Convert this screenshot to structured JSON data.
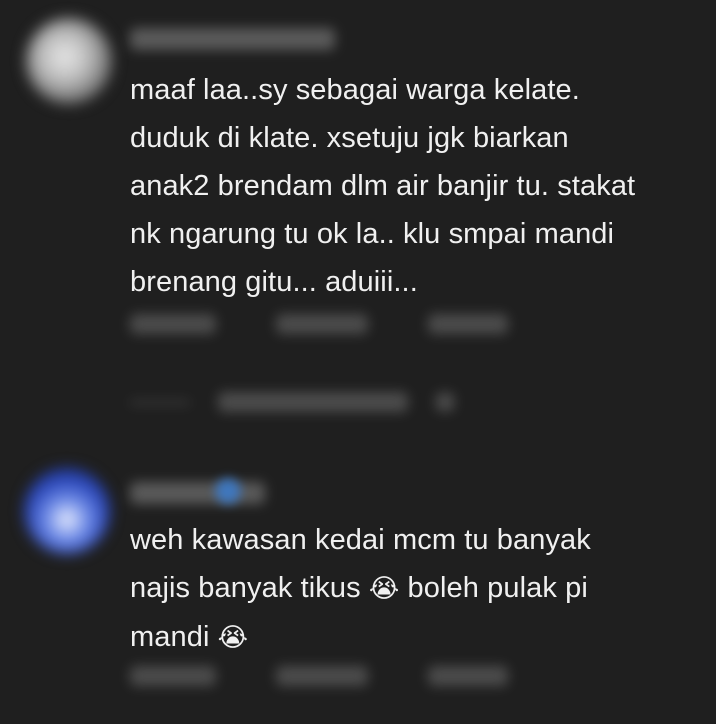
{
  "comments": [
    {
      "lines": [
        "maaf laa..sy sebagai warga kelate.",
        "duduk di klate. xsetuju jgk biarkan",
        "anak2 brendam dlm air banjir tu. stakat",
        "nk ngarung tu ok la.. klu smpai mandi",
        "brenang gitu... aduiii..."
      ]
    },
    {
      "lines": [
        "weh kawasan kedai mcm tu banyak",
        "najis banyak tikus ",
        "mandi "
      ],
      "emoji": "😭",
      "line2_suffix": " boleh pulak pi"
    }
  ],
  "colors": {
    "background": "#1f1f1f",
    "text": "#f0f0f0"
  }
}
